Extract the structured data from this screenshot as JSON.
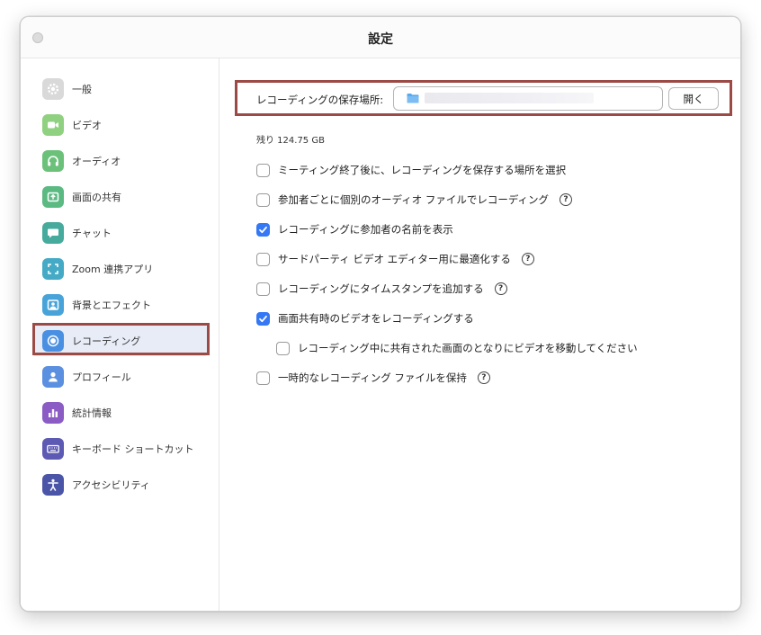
{
  "window": {
    "title": "設定"
  },
  "sidebar": {
    "items": [
      {
        "label": "一般",
        "icon": "gear-icon",
        "color": "#d9d9d9",
        "active": false
      },
      {
        "label": "ビデオ",
        "icon": "video-camera-icon",
        "color": "#8fd180",
        "active": false
      },
      {
        "label": "オーディオ",
        "icon": "headphones-icon",
        "color": "#6cc17a",
        "active": false
      },
      {
        "label": "画面の共有",
        "icon": "share-screen-icon",
        "color": "#5bba82",
        "active": false
      },
      {
        "label": "チャット",
        "icon": "chat-bubble-icon",
        "color": "#46ab9c",
        "active": false
      },
      {
        "label": "Zoom 連携アプリ",
        "icon": "apps-icon",
        "color": "#45aac6",
        "active": false
      },
      {
        "label": "背景とエフェクト",
        "icon": "background-icon",
        "color": "#48a4d8",
        "active": false
      },
      {
        "label": "レコーディング",
        "icon": "record-icon",
        "color": "#4a90e2",
        "active": true
      },
      {
        "label": "プロフィール",
        "icon": "person-icon",
        "color": "#5b8fe0",
        "active": false
      },
      {
        "label": "統計情報",
        "icon": "bar-chart-icon",
        "color": "#8a5cc4",
        "active": false
      },
      {
        "label": "キーボード ショートカット",
        "icon": "keyboard-icon",
        "color": "#5d5ab3",
        "active": false
      },
      {
        "label": "アクセシビリティ",
        "icon": "accessibility-icon",
        "color": "#4a55a8",
        "active": false
      }
    ]
  },
  "recording": {
    "location_label": "レコーディングの保存場所:",
    "open_button": "開く",
    "remaining": "残り 124.75 GB",
    "options": [
      {
        "label": "ミーティング終了後に、レコーディングを保存する場所を選択",
        "checked": false,
        "help": false,
        "indent": false
      },
      {
        "label": "参加者ごとに個別のオーディオ ファイルでレコーディング",
        "checked": false,
        "help": true,
        "indent": false
      },
      {
        "label": "レコーディングに参加者の名前を表示",
        "checked": true,
        "help": false,
        "indent": false
      },
      {
        "label": "サードパーティ ビデオ エディター用に最適化する",
        "checked": false,
        "help": true,
        "indent": false
      },
      {
        "label": "レコーディングにタイムスタンプを追加する",
        "checked": false,
        "help": true,
        "indent": false
      },
      {
        "label": "画面共有時のビデオをレコーディングする",
        "checked": true,
        "help": false,
        "indent": false
      },
      {
        "label": "レコーディング中に共有された画面のとなりにビデオを移動してください",
        "checked": false,
        "help": false,
        "indent": true
      },
      {
        "label": "一時的なレコーディング ファイルを保持",
        "checked": false,
        "help": true,
        "indent": false
      }
    ]
  },
  "colors": {
    "accent": "#3478f6",
    "highlight_border": "#9c4a46",
    "active_bg": "#e7ecf7"
  }
}
